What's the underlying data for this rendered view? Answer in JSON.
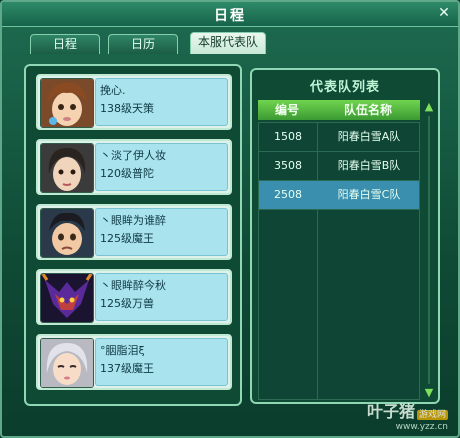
{
  "window": {
    "title": "日程",
    "close_glyph": "✕"
  },
  "tabs": [
    {
      "label": "日程",
      "active": false
    },
    {
      "label": "日历",
      "active": false
    },
    {
      "label": "本服代表队",
      "active": true
    }
  ],
  "members": [
    {
      "name": "挽心.",
      "level": "138级天策",
      "avatar": "avatar-brown-hair"
    },
    {
      "name": "丶淡了伊人妆",
      "level": "120级普陀",
      "avatar": "avatar-dark-hair"
    },
    {
      "name": "丶眼眸为谁醉",
      "level": "125级魔王",
      "avatar": "avatar-black-hair"
    },
    {
      "name": "丶眼眸醉今秋",
      "level": "125级万兽",
      "avatar": "avatar-demon"
    },
    {
      "name": "°胭脂泪ξ",
      "level": "137级魔王",
      "avatar": "avatar-silver-hair"
    }
  ],
  "team_list": {
    "title": "代表队列表",
    "columns": [
      "编号",
      "队伍名称"
    ],
    "rows": [
      {
        "id": "1508",
        "name": "阳春白雪A队",
        "selected": false
      },
      {
        "id": "3508",
        "name": "阳春白雪B队",
        "selected": false
      },
      {
        "id": "2508",
        "name": "阳春白雪C队",
        "selected": true
      }
    ],
    "scroll_up_glyph": "▲",
    "scroll_down_glyph": "▼"
  },
  "watermark": {
    "brand": "叶子猪",
    "tag": "游戏网",
    "url": "www.yzz.cn"
  },
  "colors": {
    "accent_green": "#71d44f",
    "selected_row": "#3a8fae",
    "card_info": "#a9e3ee"
  }
}
